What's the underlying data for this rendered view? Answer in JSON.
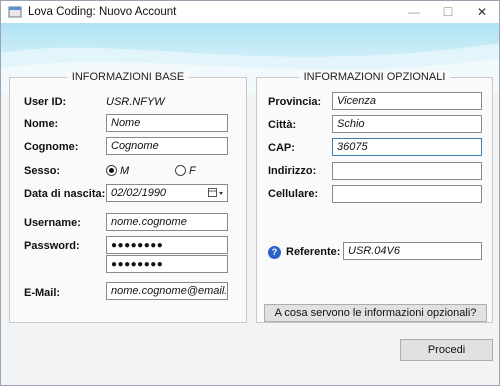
{
  "window": {
    "title": "Lova Coding: Nuovo Account",
    "minimize_glyph": "—",
    "maximize_glyph": "☐",
    "close_glyph": "✕"
  },
  "base": {
    "section_title": "INFORMAZIONI BASE",
    "user_id_label": "User ID:",
    "user_id_value": "USR.NFYW",
    "nome_label": "Nome:",
    "nome_value": "Nome",
    "cognome_label": "Cognome:",
    "cognome_value": "Cognome",
    "sesso_label": "Sesso:",
    "sesso_options": [
      "M",
      "F"
    ],
    "sesso_selected": "M",
    "nascita_label": "Data di nascita:",
    "nascita_value": "02/02/1990",
    "username_label": "Username:",
    "username_value": "nome.cognome",
    "password_label": "Password:",
    "password_value": "●●●●●●●●",
    "password_confirm_value": "●●●●●●●●",
    "email_label": "E-Mail:",
    "email_value": "nome.cognome@email.it"
  },
  "optional": {
    "section_title": "INFORMAZIONI OPZIONALI",
    "provincia_label": "Provincia:",
    "provincia_value": "Vicenza",
    "citta_label": "Città:",
    "citta_value": "Schio",
    "cap_label": "CAP:",
    "cap_value": "36075",
    "indirizzo_label": "Indirizzo:",
    "indirizzo_value": "",
    "cellulare_label": "Cellulare:",
    "cellulare_value": "",
    "referente_label": "Referente:",
    "referente_value": "USR.04V6",
    "help_glyph": "?",
    "info_button_label": "A cosa servono le informazioni opzionali?"
  },
  "actions": {
    "proceed_label": "Procedi"
  },
  "colors": {
    "banner_top": "#aee2f3",
    "focus_border": "#3c7fb1",
    "help_icon": "#2a62c9"
  }
}
